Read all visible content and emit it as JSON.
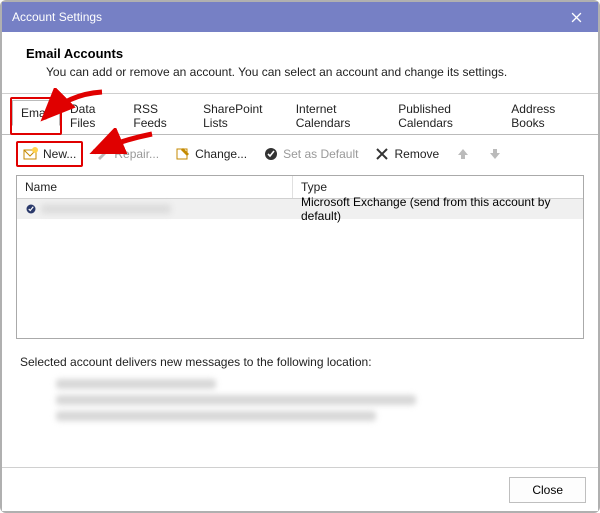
{
  "titlebar": {
    "title": "Account Settings"
  },
  "header": {
    "heading": "Email Accounts",
    "subtext": "You can add or remove an account. You can select an account and change its settings."
  },
  "tabs": {
    "items": [
      {
        "label": "Email"
      },
      {
        "label": "Data Files"
      },
      {
        "label": "RSS Feeds"
      },
      {
        "label": "SharePoint Lists"
      },
      {
        "label": "Internet Calendars"
      },
      {
        "label": "Published Calendars"
      },
      {
        "label": "Address Books"
      }
    ]
  },
  "toolbar": {
    "new": "New...",
    "repair": "Repair...",
    "change": "Change...",
    "default": "Set as Default",
    "remove": "Remove"
  },
  "table": {
    "headers": {
      "name": "Name",
      "type": "Type"
    },
    "rows": [
      {
        "name": "",
        "type": "Microsoft Exchange (send from this account by default)"
      }
    ]
  },
  "info": {
    "text": "Selected account delivers new messages to the following location:"
  },
  "footer": {
    "close": "Close"
  }
}
